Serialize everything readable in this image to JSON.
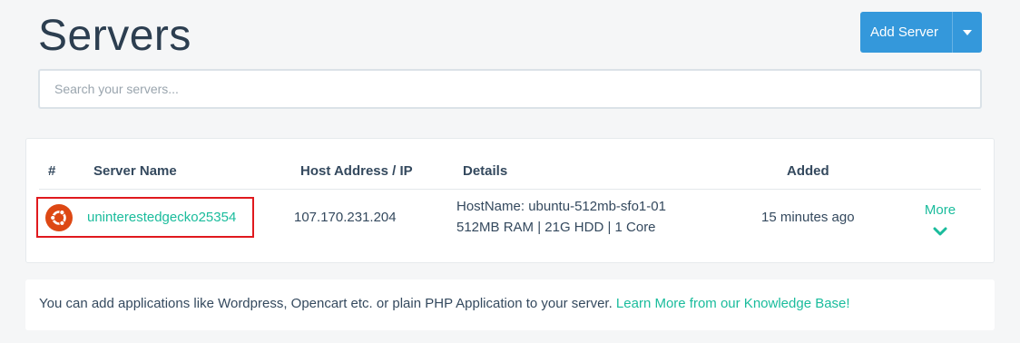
{
  "header": {
    "title": "Servers",
    "add_button_label": "Add Server",
    "caret_icon": "caret-down-icon"
  },
  "search": {
    "placeholder": "Search your servers...",
    "value": ""
  },
  "table": {
    "columns": [
      "#",
      "Server Name",
      "Host Address / IP",
      "Details",
      "Added"
    ],
    "rows": [
      {
        "os_icon": "ubuntu-icon",
        "server_name": "uninterestedgecko25354",
        "host_address": "107.170.231.204",
        "details_line1": "HostName: ubuntu-512mb-sfo1-01",
        "details_line2": "512MB RAM | 21G HDD | 1 Core",
        "added": "15 minutes ago",
        "more_label": "More"
      }
    ]
  },
  "info": {
    "text": "You can add applications like Wordpress, Opencart etc. or plain PHP Application to your server. ",
    "link_text": "Learn More from our Knowledge Base!"
  },
  "colors": {
    "accent_blue": "#3498db",
    "accent_green": "#1abc9c",
    "highlight_red": "#e0191e",
    "ubuntu_orange": "#dd4814",
    "text_dark": "#34495e"
  }
}
